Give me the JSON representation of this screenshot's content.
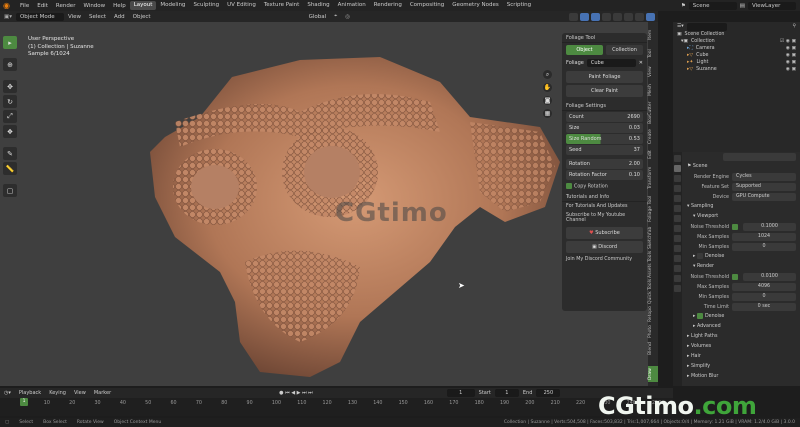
{
  "topbar": {
    "menus": [
      "File",
      "Edit",
      "Render",
      "Window",
      "Help"
    ],
    "workspaces": [
      "Layout",
      "Modeling",
      "Sculpting",
      "UV Editing",
      "Texture Paint",
      "Shading",
      "Animation",
      "Rendering",
      "Compositing",
      "Geometry Nodes",
      "Scripting"
    ],
    "active_workspace": "Layout",
    "scene": "Scene",
    "view_layer": "ViewLayer"
  },
  "viewport_header": {
    "mode": "Object Mode",
    "menus": [
      "View",
      "Select",
      "Add",
      "Object"
    ],
    "orientation": "Global",
    "options": "Options"
  },
  "viewport": {
    "perspective": "User Perspective",
    "collection": "(1) Collection | Suzanne",
    "sample": "Sample 6/1024",
    "watermark": "CGtimo"
  },
  "side_tabs": [
    "Item",
    "Tool",
    "View",
    "Mesh",
    "BoxCutter",
    "Create",
    "Edit",
    "Transform",
    "Foliage Tool",
    "Sketchfab",
    "Assets Tools",
    "Quick Tools",
    "Retopo",
    "Photo",
    "Blend",
    "Draw",
    "Keymaps",
    "Tools",
    "Misc"
  ],
  "foliage_panel": {
    "header": "Foliage Tool",
    "tab_object": "Object",
    "tab_collection": "Collection",
    "foliage_label": "Foliage",
    "foliage_object": "Cube",
    "paint_button": "Paint Foliage",
    "clear_button": "Clear Paint",
    "settings_header": "Foliage Settings",
    "settings": [
      {
        "label": "Count",
        "value": "2690"
      },
      {
        "label": "Size",
        "value": "0.03"
      },
      {
        "label": "Size Random",
        "value": "0.53"
      },
      {
        "label": "Seed",
        "value": "37"
      },
      {
        "label": "Rotation",
        "value": "2.00"
      },
      {
        "label": "Rotation Factor",
        "value": "0.10"
      }
    ],
    "copy_rotation": "Copy Rotation",
    "info_header": "Tutorials and Info",
    "info_line1": "For Tutorials And Updates",
    "info_line2": "Subscribe to My Youtube Channel",
    "subscribe_button": "Subscribe",
    "discord_button": "Discord",
    "discord_line": "Join My Discord Community"
  },
  "outliner": {
    "title": "Scene Collection",
    "items": [
      {
        "name": "Collection",
        "indent": 1
      },
      {
        "name": "Camera",
        "indent": 2
      },
      {
        "name": "Cube",
        "indent": 2
      },
      {
        "name": "Light",
        "indent": 2
      },
      {
        "name": "Suzanne",
        "indent": 2
      }
    ]
  },
  "properties": {
    "scene_label": "Scene",
    "render_engine_label": "Render Engine",
    "render_engine": "Cycles",
    "feature_set_label": "Feature Set",
    "feature_set": "Supported",
    "device_label": "Device",
    "device": "GPU Compute",
    "sampling": "Sampling",
    "viewport": "Viewport",
    "noise_threshold_label": "Noise Threshold",
    "viewport_noise_threshold": "0.1000",
    "max_samples_label": "Max Samples",
    "viewport_max_samples": "1024",
    "min_samples_label": "Min Samples",
    "viewport_min_samples": "0",
    "denoise": "Denoise",
    "render": "Render",
    "render_noise_threshold": "0.0100",
    "render_max_samples": "4096",
    "render_min_samples": "0",
    "time_limit_label": "Time Limit",
    "time_limit": "0 sec",
    "render_denoise": "Denoise",
    "advanced": "Advanced",
    "sections": [
      "Light Paths",
      "Volumes",
      "Hair",
      "Simplify",
      "Motion Blur"
    ]
  },
  "timeline": {
    "menus": [
      "Playback",
      "Keying",
      "View",
      "Marker"
    ],
    "current_frame": "1",
    "start_label": "Start",
    "start": "1",
    "end_label": "End",
    "end": "250",
    "ticks": [
      "1",
      "10",
      "20",
      "30",
      "40",
      "50",
      "60",
      "70",
      "80",
      "90",
      "100",
      "110",
      "120",
      "130",
      "140",
      "150",
      "160",
      "170",
      "180",
      "190",
      "200",
      "210",
      "220",
      "230",
      "240",
      "250"
    ]
  },
  "statusbar": {
    "select": "Select",
    "box_select": "Box Select",
    "rotate_view": "Rotate View",
    "context_menu": "Object Context Menu",
    "stats": "Collection | Suzanne | Verts:504,508 | Faces:503,832 | Tris:1,007,664 | Objects:0/4 | Memory: 1.21 GiB | VRAM: 1.2/4.0 GiB | 3.0.0"
  },
  "brand": {
    "text_a": "CGtimo",
    "text_b": ".com"
  }
}
